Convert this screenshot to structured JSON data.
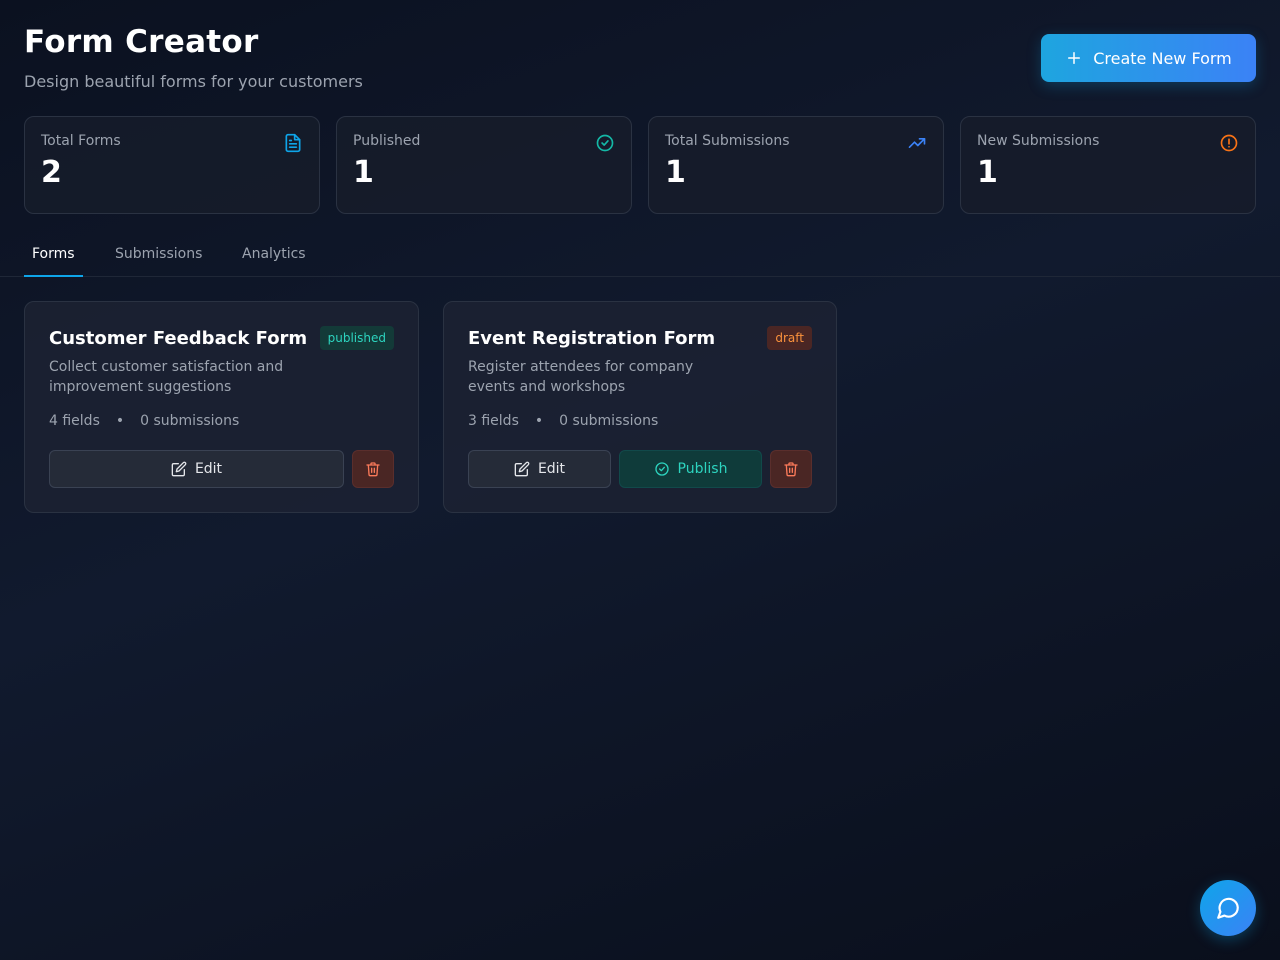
{
  "header": {
    "title": "Form Creator",
    "subtitle": "Design beautiful forms for your customers",
    "create_button_label": "Create New Form"
  },
  "stats": [
    {
      "label": "Total Forms",
      "value": "2",
      "icon": "document-icon",
      "color": "#0ea5e9"
    },
    {
      "label": "Published",
      "value": "1",
      "icon": "check-circle-icon",
      "color": "#14b8a6"
    },
    {
      "label": "Total Submissions",
      "value": "1",
      "icon": "trending-up-icon",
      "color": "#3b82f6"
    },
    {
      "label": "New Submissions",
      "value": "1",
      "icon": "alert-circle-icon",
      "color": "#f97316"
    }
  ],
  "tabs": [
    {
      "label": "Forms",
      "active": true
    },
    {
      "label": "Submissions",
      "active": false
    },
    {
      "label": "Analytics",
      "active": false
    }
  ],
  "forms": [
    {
      "title": "Customer Feedback Form",
      "status": "published",
      "description": "Collect customer satisfaction and improvement suggestions",
      "fields": "4 fields",
      "separator": "•",
      "submissions": "0 submissions",
      "edit_label": "Edit"
    },
    {
      "title": "Event Registration Form",
      "status": "draft",
      "description": "Register attendees for company events and workshops",
      "fields": "3 fields",
      "separator": "•",
      "submissions": "0 submissions",
      "edit_label": "Edit",
      "publish_label": "Publish"
    }
  ],
  "colors": {
    "accent": "#0ea5e9",
    "published": "#2dd4bf",
    "draft": "#fb923c",
    "danger": "#fb7a5a"
  }
}
